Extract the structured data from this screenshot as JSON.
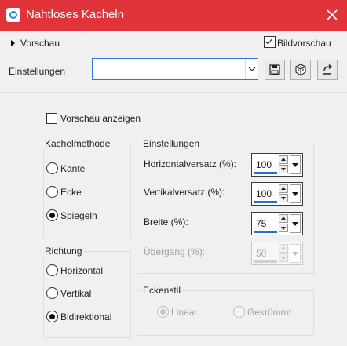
{
  "window": {
    "title": "Nahtloses Kacheln"
  },
  "top": {
    "vorschau_label": "Vorschau",
    "bildvorschau_label": "Bildvorschau",
    "bildvorschau_checked": true
  },
  "presets": {
    "label": "Einstellungen",
    "value": ""
  },
  "preview": {
    "label": "Vorschau anzeigen",
    "checked": false
  },
  "kachelmethode": {
    "label": "Kachelmethode",
    "options": [
      "Kante",
      "Ecke",
      "Spiegeln"
    ],
    "selected": "Spiegeln"
  },
  "richtung": {
    "label": "Richtung",
    "options": [
      "Horizontal",
      "Vertikal",
      "Bidirektional"
    ],
    "selected": "Bidirektional"
  },
  "einstellungen": {
    "label": "Einstellungen",
    "fields": [
      {
        "label": "Horizontalversatz (%):",
        "value": "100",
        "enabled": true
      },
      {
        "label": "Vertikalversatz (%):",
        "value": "100",
        "enabled": true
      },
      {
        "label": "Breite (%):",
        "value": "75",
        "enabled": true
      },
      {
        "label": "Übergang (%):",
        "value": "50",
        "enabled": false
      }
    ]
  },
  "eckenstil": {
    "label": "Eckenstil",
    "options": [
      "Linear",
      "Gekrümmt"
    ],
    "selected": "Linear",
    "enabled": false
  },
  "colors": {
    "titlebar": "#e0333a",
    "accent": "#1c74c6"
  },
  "icons": [
    "camera-icon",
    "close-icon",
    "save-icon",
    "cube-icon",
    "reset-icon"
  ]
}
